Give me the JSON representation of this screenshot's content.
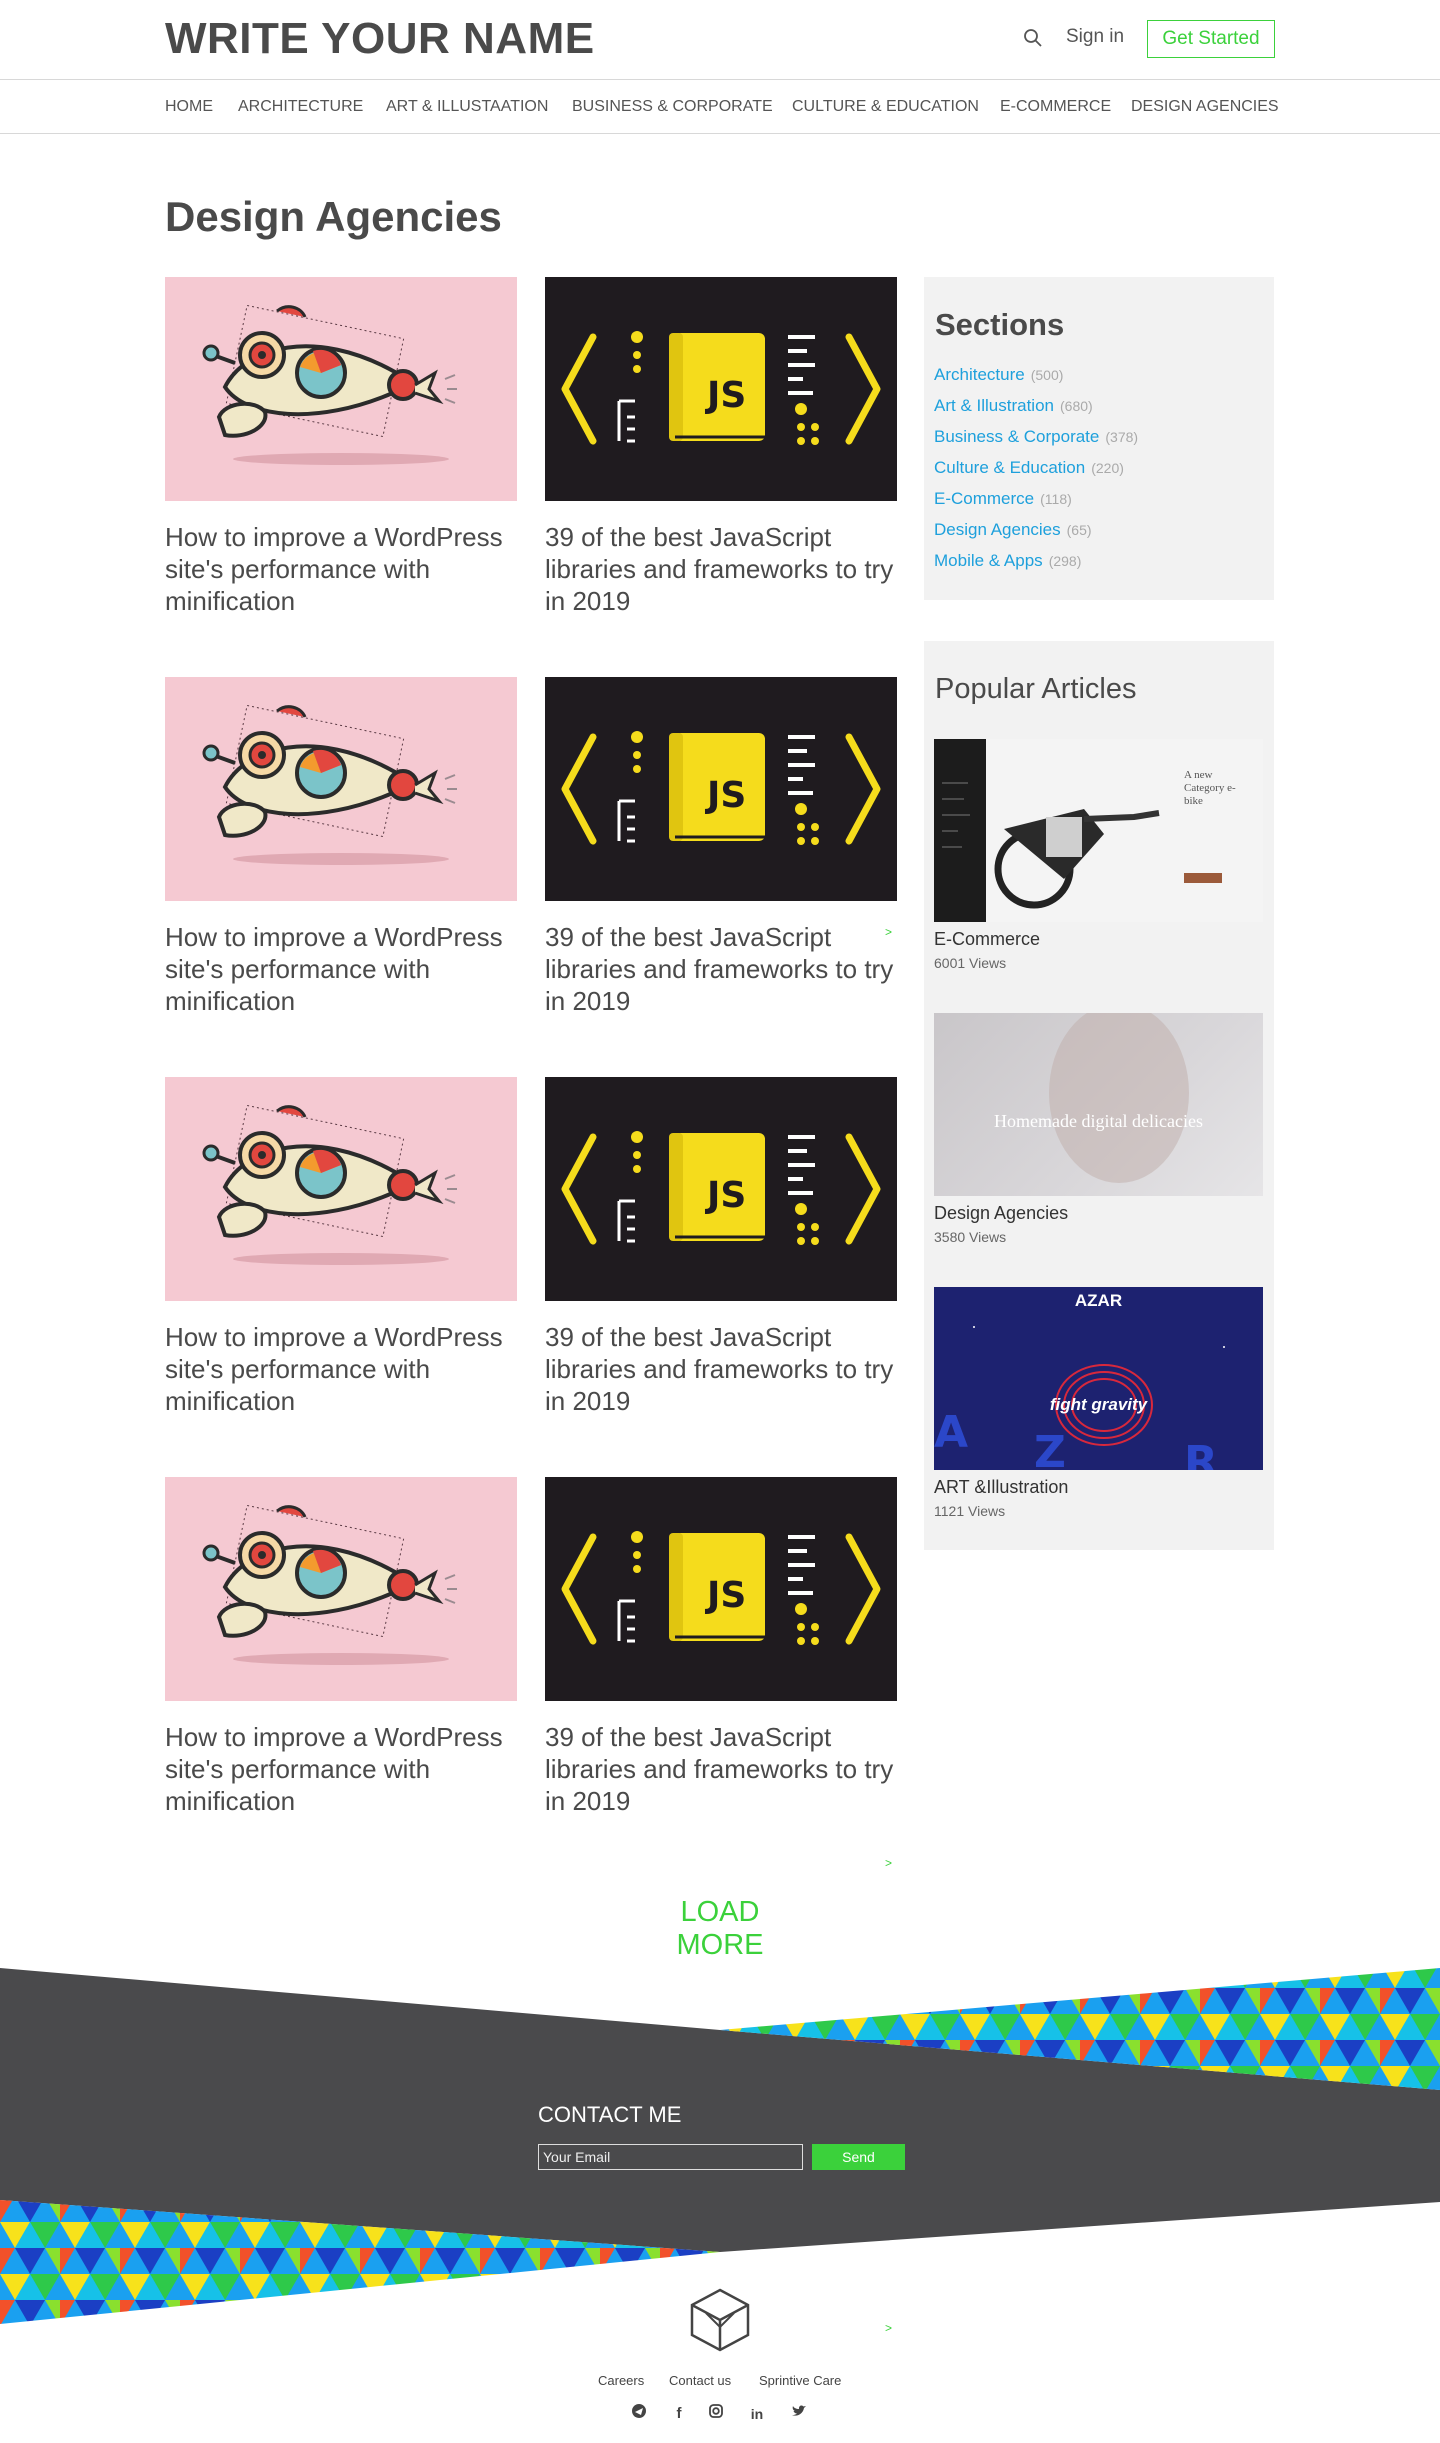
{
  "header": {
    "brand": "WRITE YOUR NAME",
    "signin_label": "Sign in",
    "get_started_label": "Get Started"
  },
  "nav": {
    "items": [
      {
        "label": "HOME"
      },
      {
        "label": "ARCHITECTURE"
      },
      {
        "label": "ART & ILLUSTAATION"
      },
      {
        "label": "BUSINESS & CORPORATE"
      },
      {
        "label": "CULTURE & EDUCATION"
      },
      {
        "label": "E-COMMERCE"
      },
      {
        "label": "DESIGN AGENCIES"
      }
    ]
  },
  "main": {
    "title": "Design Agencies",
    "cards": [
      {
        "title": "How to improve a WordPress site's performance with minification",
        "image": "rocket-illustration"
      },
      {
        "title": "39 of the best JavaScript libraries and frameworks to try in 2019",
        "image": "js-book-illustration"
      },
      {
        "title": "How to improve a WordPress site's performance with minification",
        "image": "rocket-illustration"
      },
      {
        "title": "39 of the best JavaScript libraries and frameworks to try in 2019",
        "image": "js-book-illustration"
      },
      {
        "title": "How to improve a WordPress site's performance with minification",
        "image": "rocket-illustration"
      },
      {
        "title": "39 of the best JavaScript libraries and frameworks to try in 2019",
        "image": "js-book-illustration"
      },
      {
        "title": "How to improve a WordPress site's performance with minification",
        "image": "rocket-illustration"
      },
      {
        "title": "39 of the best JavaScript libraries and frameworks to try in 2019",
        "image": "js-book-illustration"
      }
    ],
    "load_more_label": "LOAD MORE"
  },
  "sidebar": {
    "sections_title": "Sections",
    "sections": [
      {
        "label": "Architecture",
        "count": "(500)"
      },
      {
        "label": "Art & Illustration",
        "count": "(680)"
      },
      {
        "label": "Business & Corporate",
        "count": "(378)"
      },
      {
        "label": "Culture & Education",
        "count": "(220)"
      },
      {
        "label": "E-Commerce",
        "count": "(118)"
      },
      {
        "label": "Design Agencies",
        "count": "(65)"
      },
      {
        "label": "Mobile & Apps",
        "count": "(298)"
      }
    ],
    "popular_title": "Popular Articles",
    "popular": [
      {
        "name": "E-Commerce",
        "views": "6001 Views",
        "thumb_text": "A new Category e-bike"
      },
      {
        "name": "Design Agencies",
        "views": "3580 Views",
        "thumb_text": "Homemade digital delicacies"
      },
      {
        "name": "ART &Illustration",
        "views": "1121 Views",
        "thumb_text": "fight gravity",
        "thumb_brand": "AZAR"
      }
    ]
  },
  "footer": {
    "contact_title": "CONTACT ME",
    "email_placeholder": "Your Email",
    "send_label": "Send",
    "links": [
      {
        "label": "Careers"
      },
      {
        "label": "Contact us"
      },
      {
        "label": "Sprintive Care"
      }
    ],
    "social": [
      "brand-icon",
      "facebook-icon",
      "instagram-icon",
      "linkedin-icon",
      "twitter-icon"
    ],
    "accent_color": "#3bd13b",
    "dark_band_color": "#4a4a4c"
  }
}
